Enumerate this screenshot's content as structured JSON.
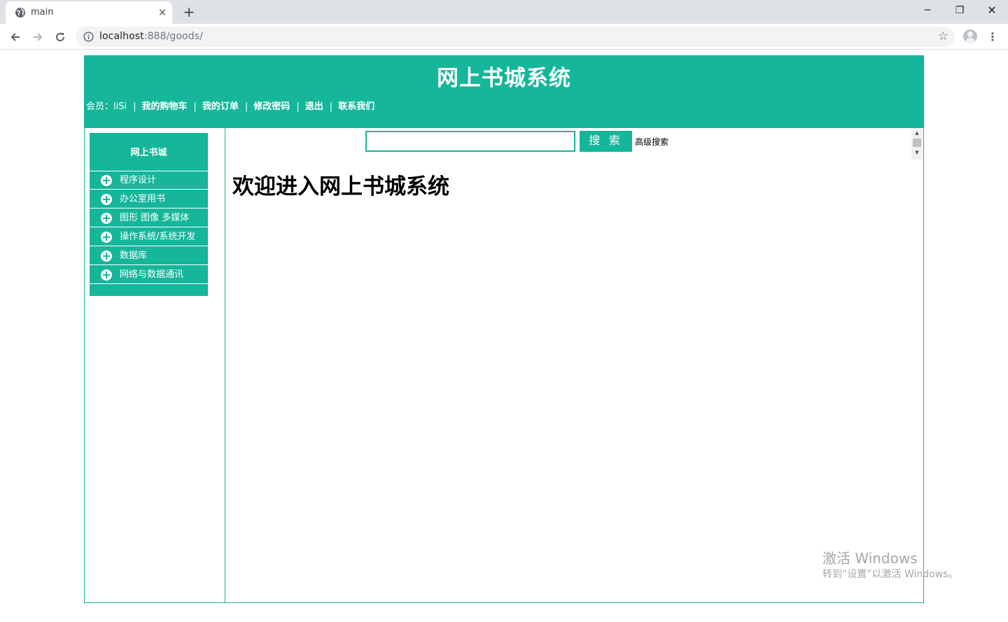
{
  "browser": {
    "tab_title": "main",
    "url_host": "localhost",
    "url_path": ":888/goods/",
    "colors": {
      "tabstrip": "#dee1e6",
      "omnibox": "#f1f3f4"
    }
  },
  "header": {
    "title": "网上书城系统",
    "member_label": "会员：liSi",
    "links": [
      "我的购物车",
      "我的订单",
      "修改密码",
      "退出",
      "联系我们"
    ],
    "separator": "|"
  },
  "sidebar": {
    "title": "网上书城",
    "items": [
      {
        "label": "程序设计",
        "icon": "plus-circle-icon"
      },
      {
        "label": "办公室用书",
        "icon": "plus-circle-icon"
      },
      {
        "label": "图形 图像 多媒体",
        "icon": "plus-circle-icon"
      },
      {
        "label": "操作系统/系统开发",
        "icon": "plus-circle-icon"
      },
      {
        "label": "数据库",
        "icon": "plus-circle-icon"
      },
      {
        "label": "网络与数据通讯",
        "icon": "plus-circle-icon"
      }
    ]
  },
  "search": {
    "value": "",
    "button_label": "搜 索",
    "advanced_label": "高级搜索"
  },
  "main": {
    "welcome": "欢迎进入网上书城系统"
  },
  "watermark": {
    "title": "激活 Windows",
    "subtitle": "转到“设置”以激活 Windows。"
  },
  "colors": {
    "accent": "#15b69a"
  }
}
